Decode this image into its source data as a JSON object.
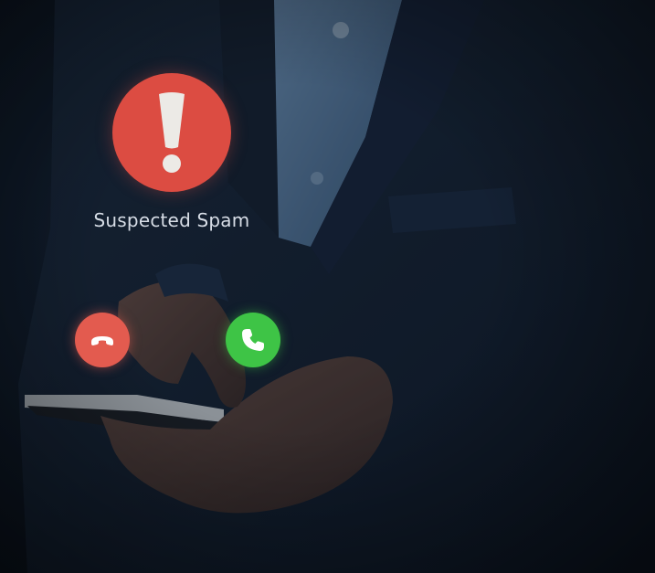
{
  "alert": {
    "label": "Suspected Spam",
    "icon": "exclamation-icon",
    "color": "#dc4c42"
  },
  "call_actions": {
    "decline": {
      "icon": "phone-hangup-icon",
      "color": "#e35b4f"
    },
    "accept": {
      "icon": "phone-icon",
      "color": "#3ec446"
    }
  }
}
